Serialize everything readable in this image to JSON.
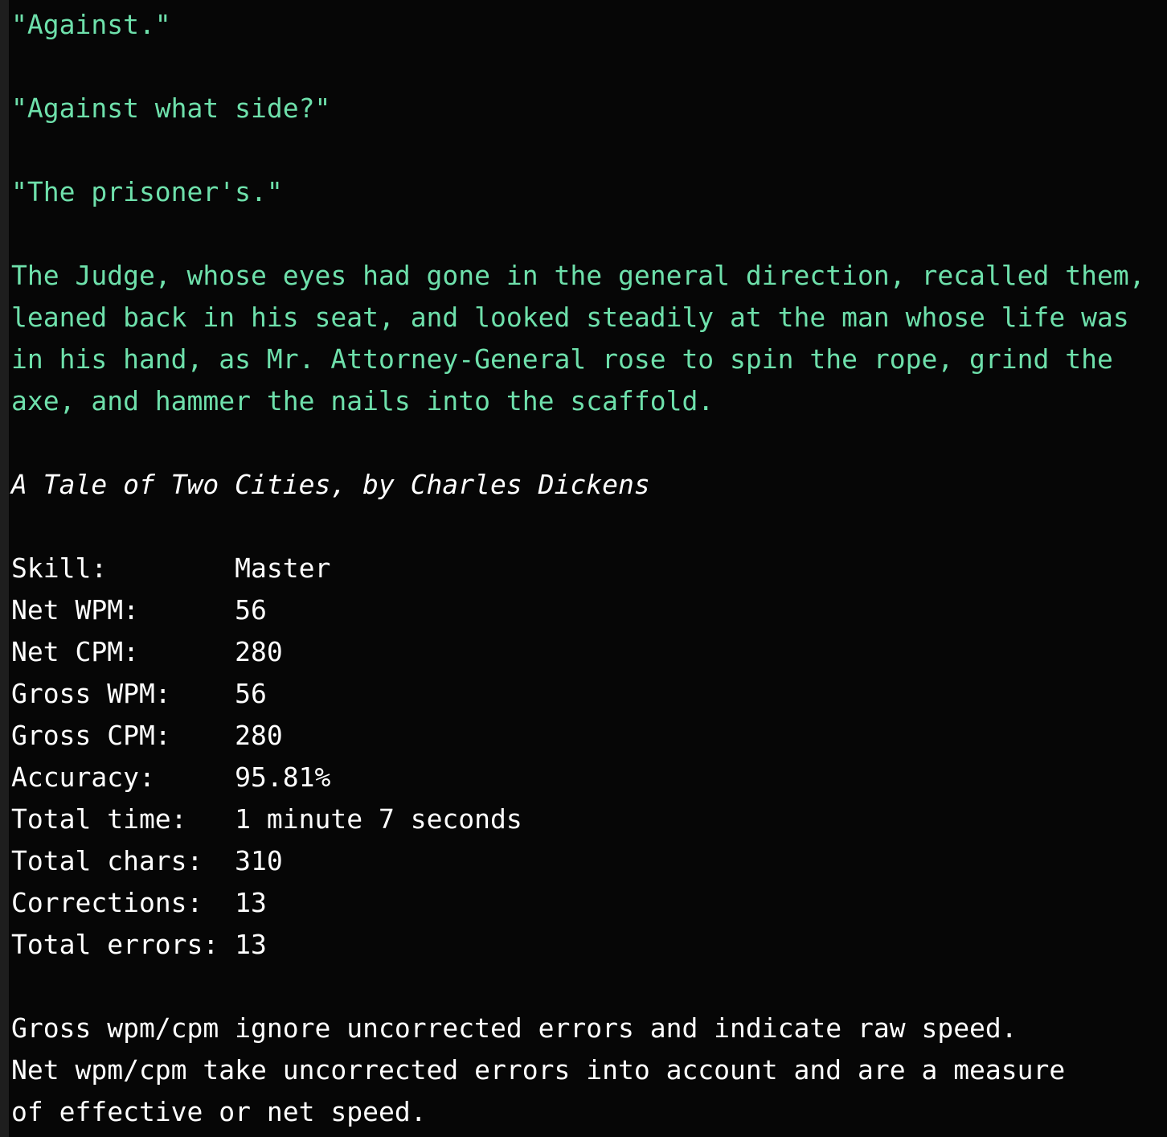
{
  "theme": {
    "background": "#060606",
    "gutter": "#1e1e1e",
    "passage_color": "#6ee0ab",
    "text_color": "#ffffff"
  },
  "passage": {
    "lines": [
      "\"Against.\"",
      "",
      "\"Against what side?\"",
      "",
      "\"The prisoner's.\"",
      "",
      "The Judge, whose eyes had gone in the general direction, recalled them,",
      "leaned back in his seat, and looked steadily at the man whose life was",
      "in his hand, as Mr. Attorney-General rose to spin the rope, grind the",
      "axe, and hammer the nails into the scaffold."
    ]
  },
  "attribution": {
    "text": "A Tale of Two Cities, by Charles Dickens"
  },
  "stats": {
    "label_column_width": 14,
    "rows": [
      {
        "label": "Skill:",
        "value": "Master"
      },
      {
        "label": "Net WPM:",
        "value": "56"
      },
      {
        "label": "Net CPM:",
        "value": "280"
      },
      {
        "label": "Gross WPM:",
        "value": "56"
      },
      {
        "label": "Gross CPM:",
        "value": "280"
      },
      {
        "label": "Accuracy:",
        "value": "95.81%"
      },
      {
        "label": "Total time:",
        "value": "1 minute 7 seconds"
      },
      {
        "label": "Total chars:",
        "value": "310"
      },
      {
        "label": "Corrections:",
        "value": "13"
      },
      {
        "label": "Total errors:",
        "value": "13"
      }
    ]
  },
  "notes": {
    "lines": [
      "Gross wpm/cpm ignore uncorrected errors and indicate raw speed.",
      "Net wpm/cpm take uncorrected errors into account and are a measure",
      "of effective or net speed."
    ]
  }
}
